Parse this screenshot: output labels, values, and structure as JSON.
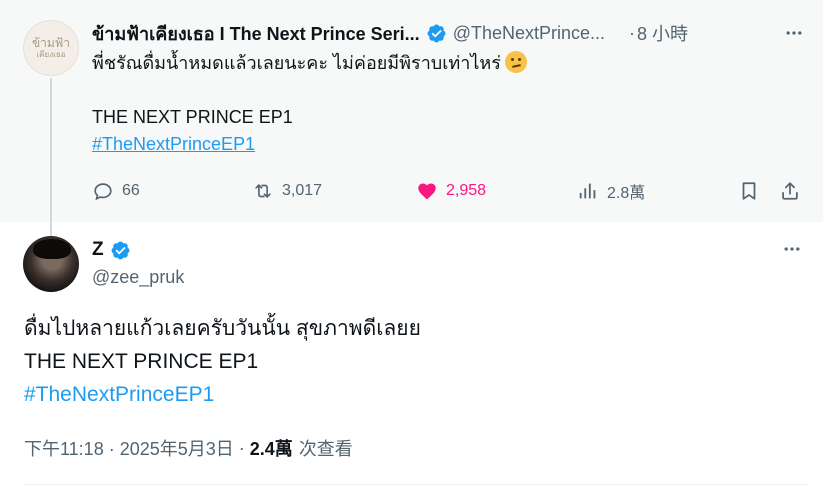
{
  "parent_post": {
    "author_name": "ข้ามฟ้าเคียงเธอ I The Next Prince Seri...",
    "avatar_text": [
      "ข้ามฟ้า",
      "เคียงเธอ"
    ],
    "handle": "@TheNextPrince...",
    "separator": "·",
    "time": "8 小時",
    "text": "พี่ชรัณดื่มน้ำหมดแล้วเลยนะคะ ไม่ค่อยมีพิราบเท่าไหร่",
    "title_line": "THE NEXT PRINCE EP1",
    "hashtag": "#TheNextPrinceEP1",
    "stats": {
      "replies": "66",
      "reposts": "3,017",
      "likes": "2,958",
      "views": "2.8萬"
    },
    "icons": [
      "reply-icon",
      "repost-icon",
      "heart-icon",
      "views-icon",
      "bookmark-icon",
      "share-icon"
    ],
    "liked": true
  },
  "main_post": {
    "author_name": "Z",
    "handle": "@zee_pruk",
    "lines": [
      "ดื่มไปหลายแก้วเลยครับวันนั้น สุขภาพดีเลยย",
      "THE NEXT PRINCE EP1"
    ],
    "hashtag": "#TheNextPrinceEP1",
    "timestamp": "下午11:18 · 2025年5月3日",
    "meta_separator": "·",
    "views_count": "2.4萬",
    "views_label": "次查看"
  },
  "colors": {
    "accent": "#1d9bf0",
    "like": "#f91880",
    "secondary_text": "#536471",
    "primary_text": "#0f1419",
    "parent_background": "#f7f9f9"
  }
}
